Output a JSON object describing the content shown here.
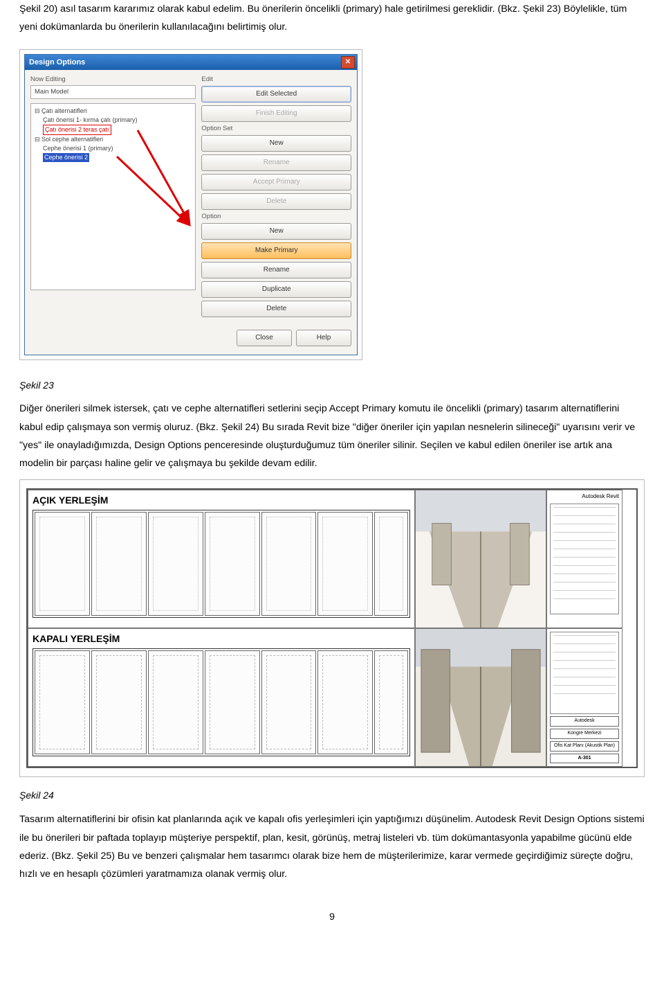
{
  "para1": "Şekil 20) asıl tasarım kararımız olarak kabul edelim. Bu önerilerin öncelikli (primary) hale getirilmesi gereklidir. (Bkz. Şekil 23) Böylelikle, tüm yeni dokümanlarda bu önerilerin kullanılacağını belirtimiş olur.",
  "fig23": {
    "title": "Design Options",
    "left_label": "Now Editing",
    "left_value": "Main Model",
    "tree": {
      "a": "Çatı alternatifleri",
      "a1": "Çatı önerisi 1- kırma çatı (primary)",
      "a2": "Çatı önerisi 2 teras çatı",
      "b": "Sol cephe alternatifleri",
      "b1": "Cephe önerisi 1 (primary)",
      "b2": "Cephe önerisi 2"
    },
    "right": {
      "g1": "Edit",
      "b1": "Edit Selected",
      "b2": "Finish Editing",
      "g2": "Option Set",
      "b3": "New",
      "b4": "Rename",
      "b5": "Accept Primary",
      "b6": "Delete",
      "g3": "Option",
      "b7": "New",
      "b8": "Make Primary",
      "b9": "Rename",
      "b10": "Duplicate",
      "b11": "Delete"
    },
    "footer": {
      "close": "Close",
      "help": "Help"
    }
  },
  "cap23": "Şekil 23",
  "para2": "Diğer önerileri silmek istersek, çatı ve cephe alternatifleri setlerini seçip Accept Primary komutu ile öncelikli (primary) tasarım alternatiflerini kabul edip çalışmaya son vermiş oluruz. (Bkz. Şekil 24) Bu sırada Revit bize \"diğer öneriler için yapılan nesnelerin silineceği\" uyarısını verir ve \"yes\" ile onayladığımızda, Design Options penceresinde oluşturduğumuz tüm öneriler silinir. Seçilen ve kabul edilen öneriler ise artık ana modelin bir parçası haline gelir ve çalışmaya bu şekilde devam edilir.",
  "fig24": {
    "label_open": "AÇIK YERLEŞİM",
    "label_closed": "KAPALI YERLEŞİM",
    "sheet_right": {
      "brand": "Autodesk Revit",
      "owner": "Autodesk",
      "proj": "Kongre Merkezi",
      "draw": "Ofis Kat Planı (Akustik Plan)",
      "no": "A-301"
    }
  },
  "cap24": "Şekil 24",
  "para3": "Tasarım alternatiflerini bir ofisin kat planlarında açık ve kapalı ofis yerleşimleri için yaptığımızı düşünelim. Autodesk Revit Design Options sistemi ile bu önerileri bir paftada toplayıp müşteriye perspektif, plan, kesit, görünüş, metraj listeleri vb. tüm dokümantasyonla yapabilme gücünü elde ederiz. (Bkz. Şekil 25) Bu ve benzeri çalışmalar hem tasarımcı olarak bize hem de müşterilerimize, karar vermede geçirdiğimiz süreçte doğru, hızlı ve en hesaplı çözümleri yaratmamıza olanak vermiş olur.",
  "page_number": "9"
}
